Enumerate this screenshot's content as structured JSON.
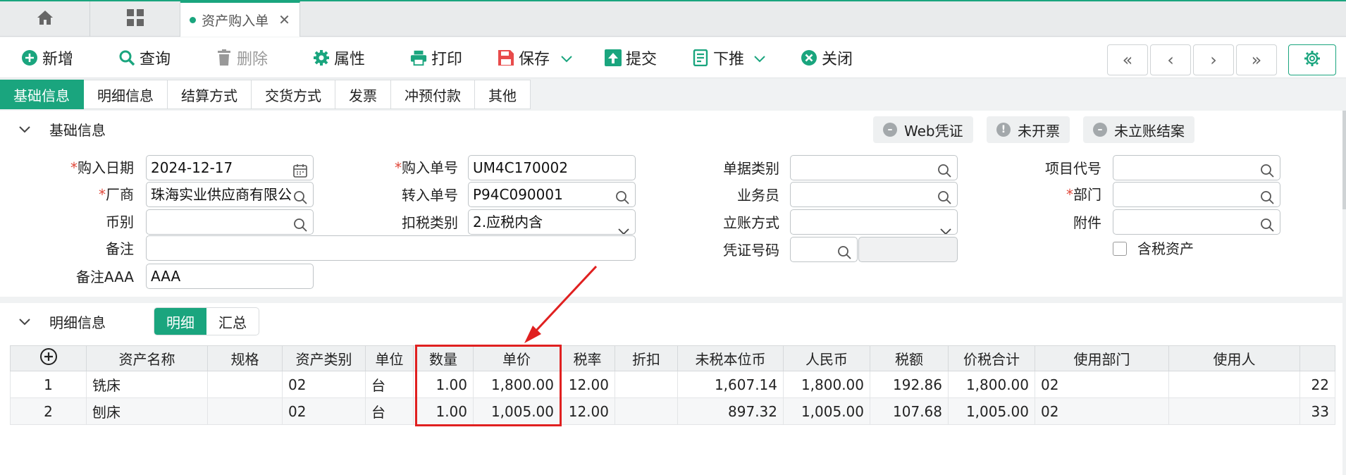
{
  "tabs": {
    "doc_title": "资产购入单",
    "close": "✕"
  },
  "toolbar": {
    "add": "新增",
    "query": "查询",
    "delete": "删除",
    "props": "属性",
    "print": "打印",
    "save": "保存",
    "submit": "提交",
    "push_down": "下推",
    "close": "关闭"
  },
  "subtabs": [
    "基础信息",
    "明细信息",
    "结算方式",
    "交货方式",
    "发票",
    "冲预付款",
    "其他"
  ],
  "basic": {
    "title": "基础信息",
    "pills": [
      "Web凭证",
      "未开票",
      "未立账结案"
    ],
    "labels": {
      "purchase_date": "购入日期",
      "purchase_no": "购入单号",
      "doc_type": "单据类别",
      "project_code": "项目代号",
      "vendor": "厂商",
      "transfer_no": "转入单号",
      "salesman": "业务员",
      "dept": "部门",
      "currency": "币别",
      "tax_type": "扣税类别",
      "account_method": "立账方式",
      "attachment": "附件",
      "remark": "备注",
      "voucher_no": "凭证号码",
      "remark_aaa": "备注AAA",
      "tax_asset": "含税资产"
    },
    "values": {
      "purchase_date": "2024-12-17",
      "purchase_no": "UM4C170002",
      "vendor": "珠海实业供应商有限公",
      "transfer_no": "P94C090001",
      "tax_type": "2.应税内含",
      "remark_aaa": "AAA"
    }
  },
  "detail": {
    "title": "明细信息",
    "toggle": [
      "明细",
      "汇总"
    ],
    "columns": [
      "资产名称",
      "规格",
      "资产类别",
      "单位",
      "数量",
      "单价",
      "税率",
      "折扣",
      "未税本位币",
      "人民币",
      "税额",
      "价税合计",
      "使用部门",
      "使用人"
    ],
    "rows": [
      {
        "no": "1",
        "name": "铣床",
        "spec": "",
        "cat": "02",
        "unit": "台",
        "qty": "1.00",
        "price": "1,800.00",
        "rate": "12.00",
        "disc": "",
        "net": "1,607.14",
        "rmb": "1,800.00",
        "tax": "192.86",
        "total": "1,800.00",
        "dept": "02",
        "user": "",
        "extra": "22"
      },
      {
        "no": "2",
        "name": "刨床",
        "spec": "",
        "cat": "02",
        "unit": "台",
        "qty": "1.00",
        "price": "1,005.00",
        "rate": "12.00",
        "disc": "",
        "net": "897.32",
        "rmb": "1,005.00",
        "tax": "107.68",
        "total": "1,005.00",
        "dept": "02",
        "user": "",
        "extra": "33"
      }
    ]
  },
  "colors": {
    "accent": "#1aa57e",
    "highlight": "#e02020"
  }
}
